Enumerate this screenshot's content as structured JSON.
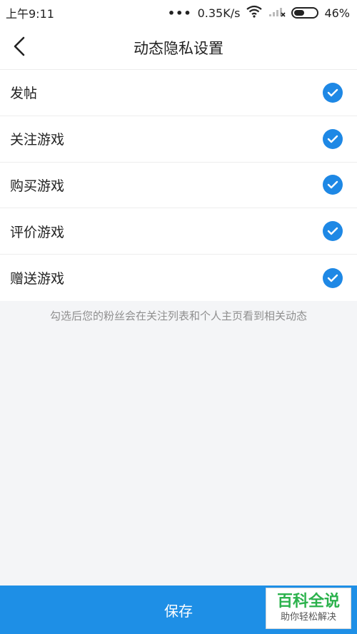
{
  "status_bar": {
    "time": "上午9:11",
    "dots": "•••",
    "speed": "0.35K/s",
    "battery": "46%",
    "battery_level": 0.46
  },
  "header": {
    "title": "动态隐私设置",
    "back_icon": "chevron-left-icon"
  },
  "settings": {
    "items": [
      {
        "label": "发帖",
        "checked": true
      },
      {
        "label": "关注游戏",
        "checked": true
      },
      {
        "label": "购买游戏",
        "checked": true
      },
      {
        "label": "评价游戏",
        "checked": true
      },
      {
        "label": "赠送游戏",
        "checked": true
      }
    ],
    "hint": "勾选后您的粉丝会在关注列表和个人主页看到相关动态"
  },
  "footer": {
    "save_label": "保存"
  },
  "watermark": {
    "main": "百科全说",
    "sub": "助你轻松解决"
  },
  "colors": {
    "accent": "#1e8fe6",
    "check": "#1e88e5",
    "watermark_green": "#2bb24c"
  }
}
